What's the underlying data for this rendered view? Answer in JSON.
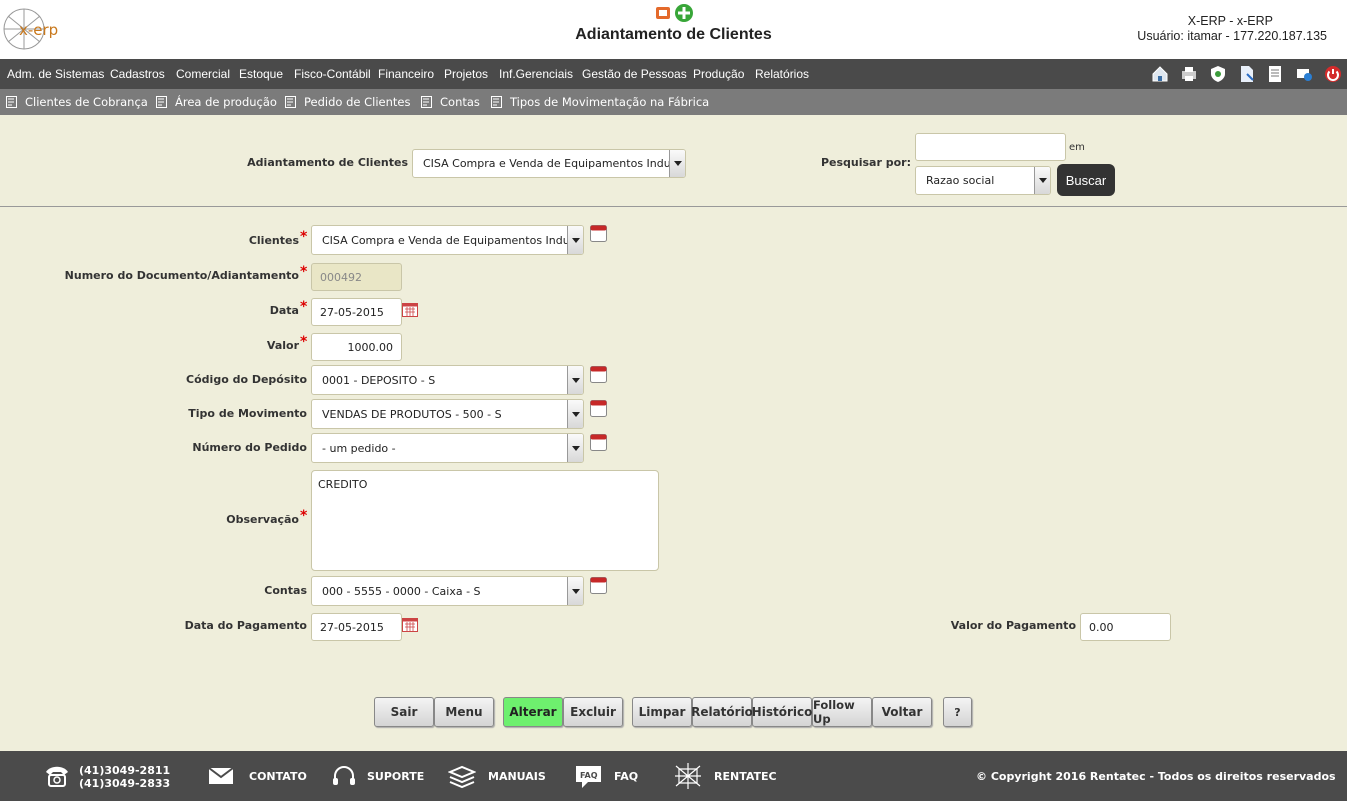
{
  "header": {
    "logo_text": "x-erp",
    "title": "Adiantamento de Clientes",
    "system_name": "X-ERP - x-ERP",
    "user_line": "Usuário: itamar - 177.220.187.135"
  },
  "menu": {
    "items": [
      "Adm. de Sistemas",
      "Cadastros",
      "Comercial",
      "Estoque",
      "Fisco-Contábil",
      "Financeiro",
      "Projetos",
      "Inf.Gerenciais",
      "Gestão de Pessoas",
      "Produção",
      "Relatórios"
    ],
    "tools": [
      "home-icon",
      "print-icon",
      "shield-icon",
      "document-icon",
      "notes-icon",
      "help-icon",
      "power-icon"
    ]
  },
  "shortcuts": [
    "Clientes de Cobrança",
    "Área de produção",
    "Pedido de Clientes",
    "Contas",
    "Tipos de Movimentação na Fábrica"
  ],
  "search": {
    "entity_label": "Adiantamento de Clientes",
    "entity_value": "CISA Compra e Venda de Equipamentos Industriais",
    "search_by_label": "Pesquisar por:",
    "search_value": "",
    "em_label": "em",
    "search_field": "Razao social",
    "buscar_label": "Buscar"
  },
  "form": {
    "clientes_label": "Clientes",
    "clientes_value": "CISA Compra e Venda de Equipamentos Industriais",
    "numero_label": "Numero do Documento/Adiantamento",
    "numero_value": "000492",
    "data_label": "Data",
    "data_value": "27-05-2015",
    "valor_label": "Valor",
    "valor_value": "1000.00",
    "deposito_label": "Código do Depósito",
    "deposito_value": "0001 - DEPOSITO - S",
    "movimento_label": "Tipo de Movimento",
    "movimento_value": "VENDAS DE PRODUTOS - 500 - S",
    "pedido_label": "Número do Pedido",
    "pedido_value": "- um pedido -",
    "observacao_label": "Observação",
    "observacao_value": "CREDITO",
    "contas_label": "Contas",
    "contas_value": "000 - 5555 - 0000 - Caixa - S",
    "data_pagamento_label": "Data do Pagamento",
    "data_pagamento_value": "27-05-2015",
    "valor_pagamento_label": "Valor do Pagamento",
    "valor_pagamento_value": "0.00"
  },
  "buttons": {
    "sair": "Sair",
    "menu": "Menu",
    "alterar": "Alterar",
    "excluir": "Excluir",
    "limpar": "Limpar",
    "relatorio": "Relatório",
    "historico": "Histórico",
    "followup": "Follow Up",
    "voltar": "Voltar",
    "help": "?"
  },
  "footer": {
    "phone1": "(41)3049-2811",
    "phone2": "(41)3049-2833",
    "contato": "CONTATO",
    "suporte": "SUPORTE",
    "manuais": "MANUAIS",
    "faq": "FAQ",
    "rentatec": "RENTATEC",
    "copyright": "© Copyright 2016 Rentatec - Todos os direitos reservados"
  },
  "colors": {
    "background": "#efeedb",
    "menubar": "#4a4a4a",
    "subbar": "#7b7b7b",
    "footer": "#4b4b4b",
    "required": "#dd0000",
    "primary_button": "#6ef06e"
  }
}
